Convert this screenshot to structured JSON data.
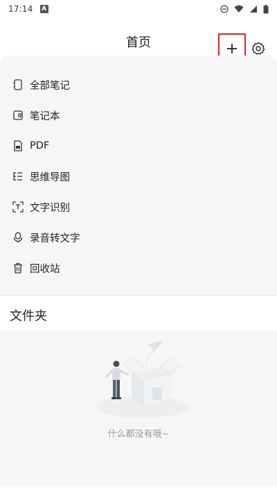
{
  "status_bar": {
    "time": "17:14",
    "a_icon_label": "A"
  },
  "header": {
    "title": "首页"
  },
  "nav": {
    "items": [
      {
        "label": "全部笔记",
        "icon": "notebook-icon"
      },
      {
        "label": "笔记本",
        "icon": "folder-book-icon"
      },
      {
        "label": "PDF",
        "icon": "pdf-icon"
      },
      {
        "label": "思维导图",
        "icon": "mindmap-icon"
      },
      {
        "label": "文字识别",
        "icon": "scan-text-icon"
      },
      {
        "label": "录音转文字",
        "icon": "microphone-icon"
      },
      {
        "label": "回收站",
        "icon": "trash-icon"
      }
    ]
  },
  "folders": {
    "title": "文件夹",
    "empty_text": "什么都没有哦~"
  },
  "colors": {
    "highlight": "#e02020",
    "panel_bg": "#f6f6f6"
  }
}
